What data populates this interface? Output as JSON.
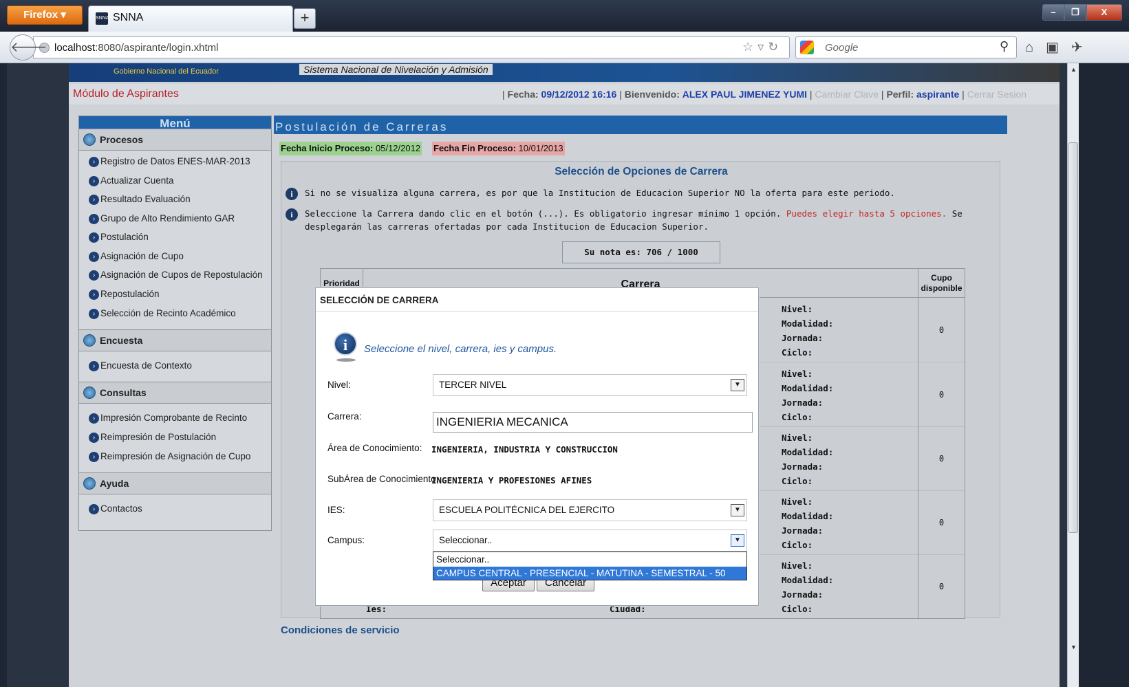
{
  "browser": {
    "app_button": "Firefox",
    "tab_title": "SNNA",
    "tab_icon_text": "SNNA",
    "new_tab": "+",
    "url_host": "localhost",
    "url_rest": ":8080/aspirante/login.xhtml",
    "search_placeholder": "Google",
    "window_controls": {
      "minimize": "–",
      "maximize": "❐",
      "close": "X"
    }
  },
  "banner": {
    "gobierno": "Gobierno Nacional del Ecuador",
    "sistema": "Sistema Nacional de Nivelación y Admisión"
  },
  "header": {
    "module_title": "Módulo de Aspirantes",
    "fecha_label": "Fecha:",
    "fecha_value": "09/12/2012 16:16",
    "bienvenido_label": "Bienvenido:",
    "user_name": "ALEX PAUL JIMENEZ YUMI",
    "cambiar_clave": "Cambiar Clave",
    "perfil_label": "Perfil:",
    "perfil_value": "aspirante",
    "cerrar_sesion": "Cerrar Sesion"
  },
  "menu": {
    "title": "Menú",
    "sections": [
      {
        "label": "Procesos",
        "items": [
          "Registro de Datos ENES-MAR-2013",
          "Actualizar Cuenta",
          "Resultado Evaluación",
          "Grupo de Alto Rendimiento GAR",
          "Postulación",
          "Asignación de Cupo",
          "Asignación de Cupos de Repostulación",
          "Repostulación",
          "Selección de Recinto Académico"
        ]
      },
      {
        "label": "Encuesta",
        "items": [
          "Encuesta de Contexto"
        ]
      },
      {
        "label": "Consultas",
        "items": [
          "Impresión Comprobante de Recinto",
          "Reimpresión de Postulación",
          "Reimpresión de Asignación de Cupo"
        ]
      },
      {
        "label": "Ayuda",
        "items": [
          "Contactos"
        ]
      }
    ]
  },
  "content": {
    "title": "Postulación de Carreras",
    "fecha_inicio_label": "Fecha Inicio Proceso:",
    "fecha_inicio_value": "05/12/2012",
    "fecha_fin_label": "Fecha Fin Proceso:",
    "fecha_fin_value": "10/01/2013",
    "panel_title": "Selección de Opciones de Carrera",
    "info1": "Si no se visualiza alguna carrera, es por que la Institucion de Educacion Superior NO la oferta para este periodo.",
    "info2_a": "Seleccione la Carrera dando clic en el botón (...). Es obligatorio ingresar mínimo 1 opción.",
    "info2_red": "Puedes elegir hasta 5 opciones.",
    "info2_b": "Se desplegarán las carreras ofertadas por cada Institucion de Educacion Superior.",
    "nota": "Su nota es: 706 / 1000",
    "table": {
      "headers": {
        "prioridad": "Prioridad",
        "carrera": "Carrera",
        "cupo": "Cupo disponible"
      },
      "row_labels": [
        "Nivel:",
        "Modalidad:",
        "Jornada:",
        "Ciclo:"
      ],
      "rows": [
        {
          "cupo": "0"
        },
        {
          "cupo": "0"
        },
        {
          "cupo": "0"
        },
        {
          "cupo": "0"
        },
        {
          "cupo": "0"
        }
      ],
      "ghost_ies": "Ies:",
      "ghost_ciudad": "Ciudad:"
    },
    "condiciones": "Condiciones de servicio"
  },
  "dialog": {
    "title": "SELECCIÓN DE CARRERA",
    "message": "Seleccione el nivel, carrera, ies y campus.",
    "nivel_label": "Nivel:",
    "nivel_value": "TERCER NIVEL",
    "carrera_label": "Carrera:",
    "carrera_value": "INGENIERIA MECANICA",
    "area_label": "Área de Conocimiento:",
    "area_value": "INGENIERIA, INDUSTRIA Y CONSTRUCCION",
    "subarea_label": "SubÁrea de Conocimiento:",
    "subarea_value": "INGENIERIA Y PROFESIONES AFINES",
    "ies_label": "IES:",
    "ies_value": "ESCUELA POLITÉCNICA DEL EJERCITO",
    "campus_label": "Campus:",
    "campus_value": "Seleccionar..",
    "campus_options": [
      "Seleccionar..",
      "CAMPUS CENTRAL - PRESENCIAL - MATUTINA - SEMESTRAL - 50"
    ],
    "aceptar": "Aceptar",
    "cancelar": "Cancelar"
  }
}
